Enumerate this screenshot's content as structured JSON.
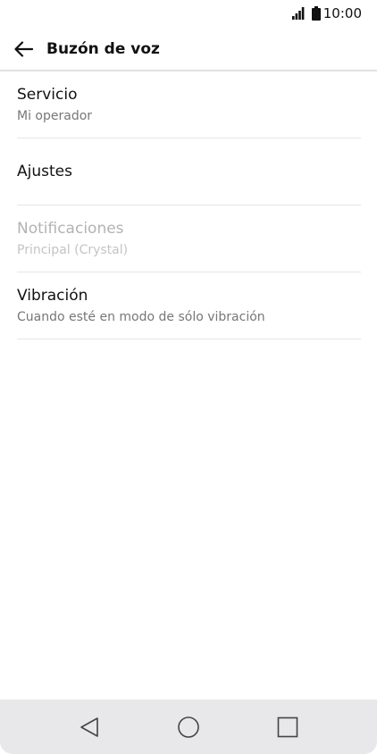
{
  "status_bar": {
    "time": "10:00",
    "icons": [
      "signal-icon",
      "battery-icon"
    ]
  },
  "header": {
    "title": "Buzón de voz",
    "back_icon": "arrow-left-icon"
  },
  "settings": {
    "items": [
      {
        "title": "Servicio",
        "summary": "Mi operador",
        "enabled": true
      },
      {
        "title": "Ajustes",
        "summary": "",
        "enabled": true
      },
      {
        "title": "Notificaciones",
        "summary": "Principal (Crystal)",
        "enabled": false
      },
      {
        "title": "Vibración",
        "summary": "Cuando esté en modo de sólo vibración",
        "enabled": true
      }
    ]
  },
  "nav_bar": {
    "icons": [
      "nav-back-icon",
      "nav-home-icon",
      "nav-recents-icon"
    ]
  },
  "colors": {
    "text_primary": "#111111",
    "text_secondary": "#777777",
    "text_disabled": "#b3b3b3",
    "divider": "#e6e6e6",
    "nav_background": "#e8e8ea"
  }
}
